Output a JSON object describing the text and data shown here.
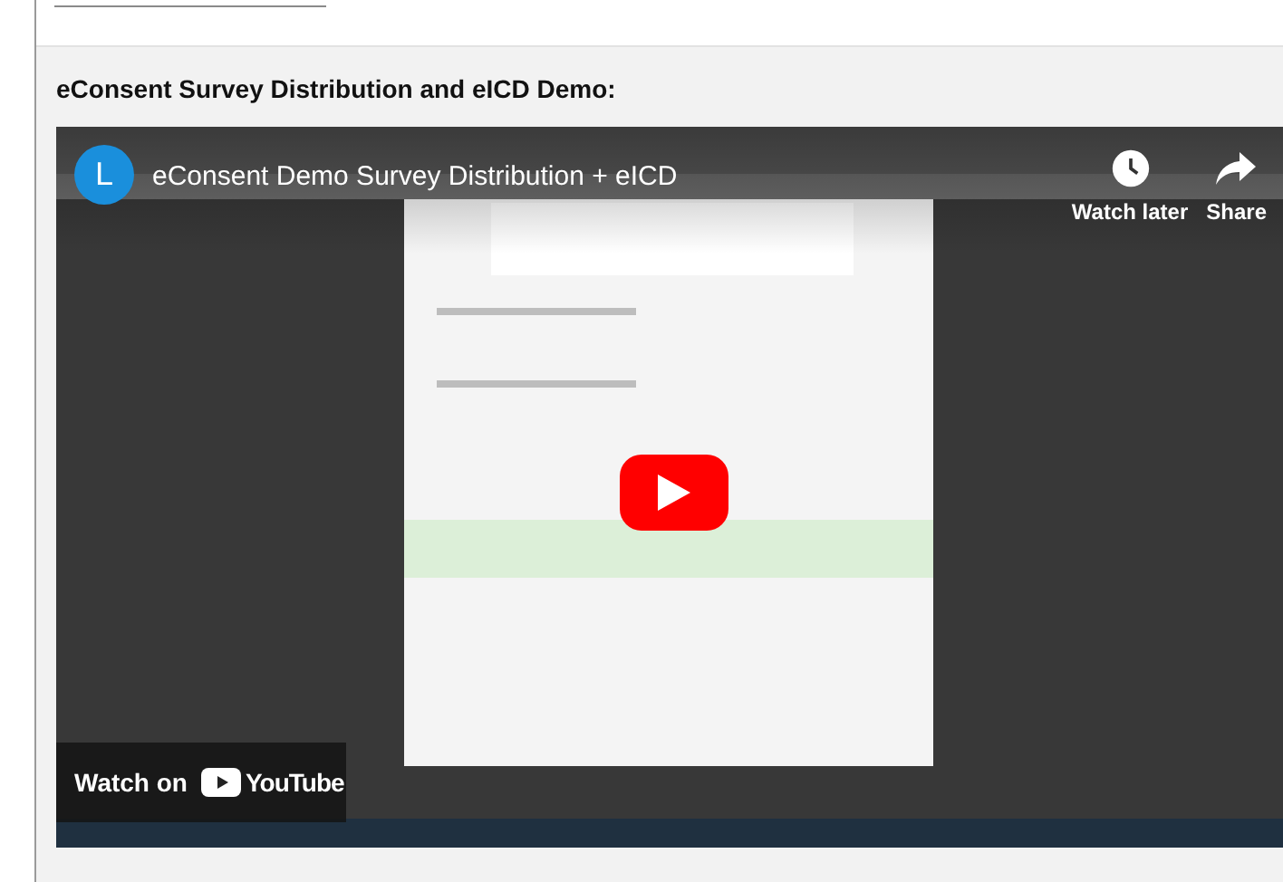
{
  "heading": "eConsent Survey Distribution and eICD Demo:",
  "video": {
    "channel_initial": "L",
    "title": "eConsent Demo Survey Distribution + eICD",
    "watch_later": "Watch later",
    "share": "Share",
    "watch_on": "Watch on",
    "brand": "YouTube"
  }
}
